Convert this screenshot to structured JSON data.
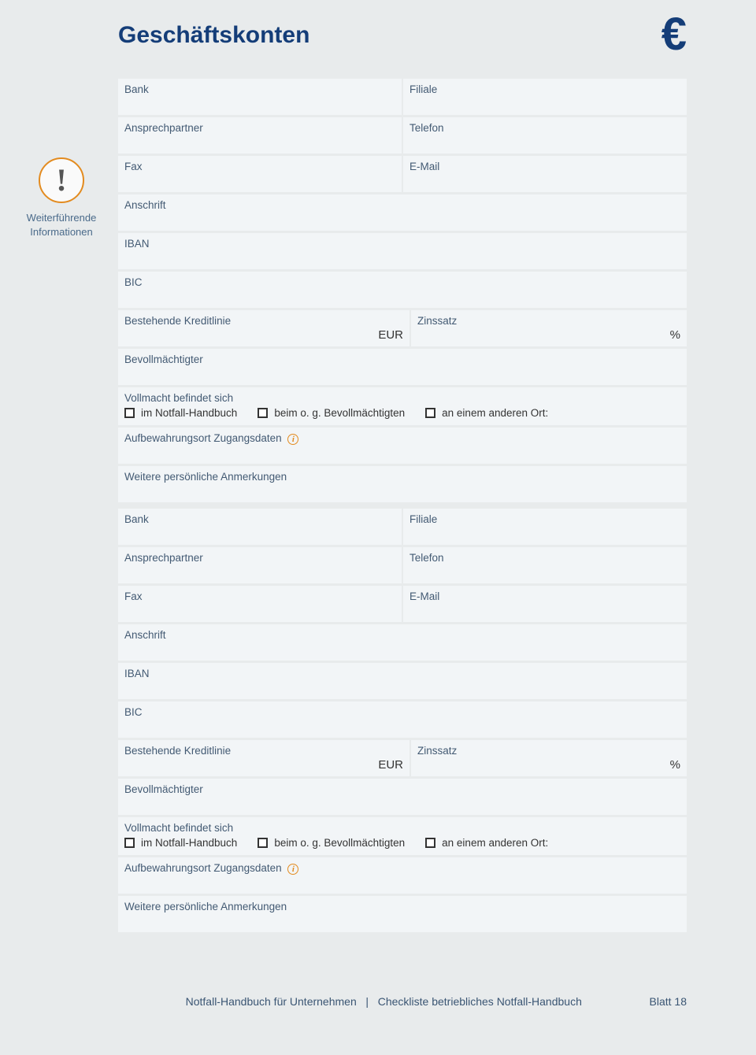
{
  "title": "Geschäftskonten",
  "euro_symbol": "€",
  "side": {
    "line1": "Weiterführende",
    "line2": "Informationen",
    "mark": "!"
  },
  "fields": {
    "bank": "Bank",
    "filiale": "Filiale",
    "ansprechpartner": "Ansprechpartner",
    "telefon": "Telefon",
    "fax": "Fax",
    "email": "E-Mail",
    "anschrift": "Anschrift",
    "iban": "IBAN",
    "bic": "BIC",
    "kreditlinie": "Bestehende Kreditlinie",
    "kreditlinie_unit": "EUR",
    "zinssatz": "Zinssatz",
    "zinssatz_unit": "%",
    "bevollmaechtigter": "Bevollmächtigter",
    "vollmacht_heading": "Vollmacht befindet sich",
    "chk1": "im Notfall-Handbuch",
    "chk2": "beim o. g. Bevollmächtigten",
    "chk3": "an einem anderen Ort:",
    "aufbewahrung": "Aufbewahrungsort Zugangsdaten",
    "anmerkungen": "Weitere persönliche Anmerkungen",
    "info_glyph": "i"
  },
  "footer": {
    "left": "Notfall-Handbuch für Unternehmen",
    "sep": "|",
    "right_center": "Checkliste betriebliches Notfall-Handbuch",
    "page": "Blatt 18"
  }
}
